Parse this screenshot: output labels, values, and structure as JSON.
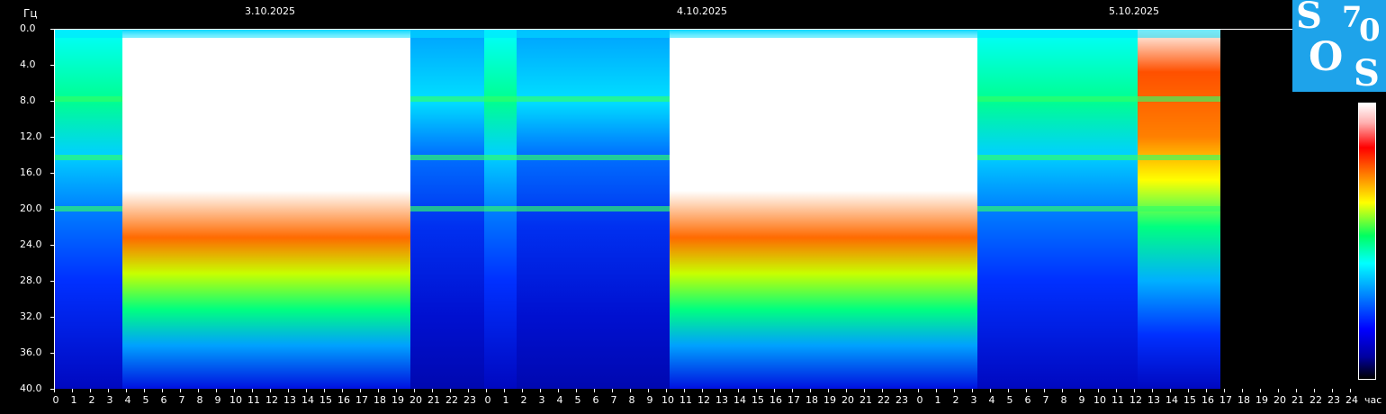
{
  "chart_data": {
    "type": "heatmap",
    "title": "",
    "ylabel": "Гц",
    "xlabel": "час",
    "ylim": [
      0,
      40
    ],
    "xlim_hours": [
      0,
      72
    ],
    "y_ticks": [
      "0.0",
      "4.0",
      "8.0",
      "12.0",
      "16.0",
      "20.0",
      "24.0",
      "28.0",
      "32.0",
      "36.0",
      "40.0"
    ],
    "x_tick_labels": [
      "0",
      "1",
      "2",
      "3",
      "4",
      "5",
      "6",
      "7",
      "8",
      "9",
      "10",
      "11",
      "12",
      "13",
      "14",
      "15",
      "16",
      "17",
      "18",
      "19",
      "20",
      "21",
      "22",
      "23",
      "0",
      "1",
      "2",
      "3",
      "4",
      "5",
      "6",
      "7",
      "8",
      "9",
      "10",
      "11",
      "12",
      "13",
      "14",
      "15",
      "16",
      "17",
      "18",
      "19",
      "20",
      "21",
      "22",
      "23",
      "0",
      "1",
      "2",
      "3",
      "4",
      "5",
      "6",
      "7",
      "8",
      "9",
      "10",
      "11",
      "12",
      "13",
      "14",
      "15",
      "16",
      "17",
      "18",
      "19",
      "20",
      "21",
      "22",
      "23",
      "24"
    ],
    "dates": [
      {
        "label": "3.10.2025",
        "hour": 12
      },
      {
        "label": "4.10.2025",
        "hour": 36
      },
      {
        "label": "5.10.2025",
        "hour": 60
      }
    ],
    "data_end_hour": 64.8,
    "bands_hz": [
      7.8,
      14.3,
      20.0
    ],
    "intensity_segments": [
      {
        "start_hour": 0.0,
        "end_hour": 3.8,
        "level": 0.45
      },
      {
        "start_hour": 3.8,
        "end_hour": 19.8,
        "level": 0.95
      },
      {
        "start_hour": 19.8,
        "end_hour": 23.9,
        "level": 0.3
      },
      {
        "start_hour": 23.9,
        "end_hour": 25.7,
        "level": 0.55
      },
      {
        "start_hour": 25.7,
        "end_hour": 34.2,
        "level": 0.3
      },
      {
        "start_hour": 34.2,
        "end_hour": 51.3,
        "level": 0.95
      },
      {
        "start_hour": 51.3,
        "end_hour": 60.2,
        "level": 0.5
      },
      {
        "start_hour": 60.2,
        "end_hour": 64.8,
        "level": 0.7
      }
    ],
    "colorscale": [
      "#00008b",
      "#0000ff",
      "#0080ff",
      "#00ffff",
      "#00ff60",
      "#ffff00",
      "#ff8000",
      "#ff0000",
      "#ffffff"
    ]
  },
  "logo": {
    "s1": "S",
    "seven": "7",
    "zero": "0",
    "o": "O",
    "s2": "S"
  }
}
